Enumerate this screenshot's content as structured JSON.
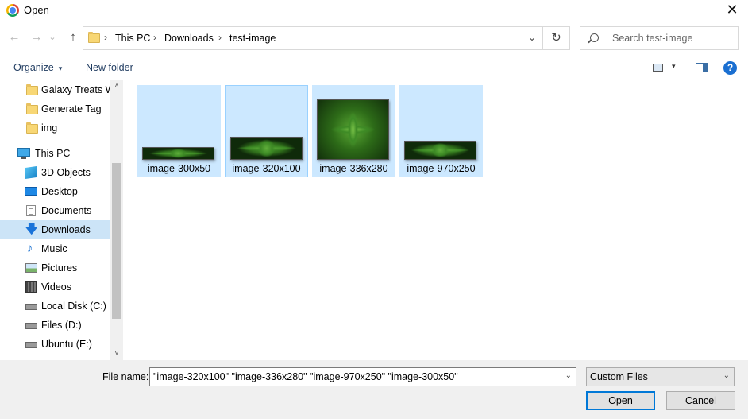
{
  "window": {
    "title": "Open",
    "close_glyph": "✕"
  },
  "nav": {
    "back_glyph": "←",
    "forward_glyph": "→",
    "history_glyph": "⌄",
    "up_glyph": "↑",
    "breadcrumb": [
      "This PC",
      "Downloads",
      "test-image"
    ],
    "separator": "›",
    "dropdown_glyph": "⌄",
    "refresh_glyph": "↻",
    "search_placeholder": "Search test-image"
  },
  "toolbar": {
    "organize_label": "Organize",
    "new_folder_label": "New folder",
    "caret": "▾",
    "help_label": "?"
  },
  "sidebar": {
    "scroll_up": "˄",
    "scroll_down": "˅",
    "items": [
      {
        "label": "Galaxy Treats Web",
        "icon": "folder-icon"
      },
      {
        "label": "Generate Tag",
        "icon": "folder-icon"
      },
      {
        "label": "img",
        "icon": "folder-icon"
      },
      {
        "label": "This PC",
        "icon": "computer-icon"
      },
      {
        "label": "3D Objects",
        "icon": "cube-icon"
      },
      {
        "label": "Desktop",
        "icon": "desktop-icon"
      },
      {
        "label": "Documents",
        "icon": "document-icon"
      },
      {
        "label": "Downloads",
        "icon": "download-arrow-icon",
        "selected": true,
        "glyph": "🡇"
      },
      {
        "label": "Music",
        "icon": "music-note-icon",
        "glyph": "♪"
      },
      {
        "label": "Pictures",
        "icon": "pictures-icon"
      },
      {
        "label": "Videos",
        "icon": "film-icon"
      },
      {
        "label": "Local Disk (C:)",
        "icon": "drive-icon"
      },
      {
        "label": "Files (D:)",
        "icon": "drive-icon"
      },
      {
        "label": "Ubuntu (E:)",
        "icon": "drive-icon"
      }
    ]
  },
  "files": [
    {
      "name": "image-300x50",
      "selected": true
    },
    {
      "name": "image-320x100",
      "selected": true,
      "focused": true
    },
    {
      "name": "image-336x280",
      "selected": true
    },
    {
      "name": "image-970x250",
      "selected": true
    }
  ],
  "footer": {
    "file_name_label": "File name:",
    "file_name_value": "\"image-320x100\" \"image-336x280\" \"image-970x250\" \"image-300x50\"",
    "file_type_value": "Custom Files",
    "dropdown_glyph": "⌄",
    "open_label": "Open",
    "cancel_label": "Cancel"
  },
  "colors": {
    "selection": "#cce8ff",
    "accent": "#0078d7",
    "sidebar_selected": "#cce4f7"
  }
}
